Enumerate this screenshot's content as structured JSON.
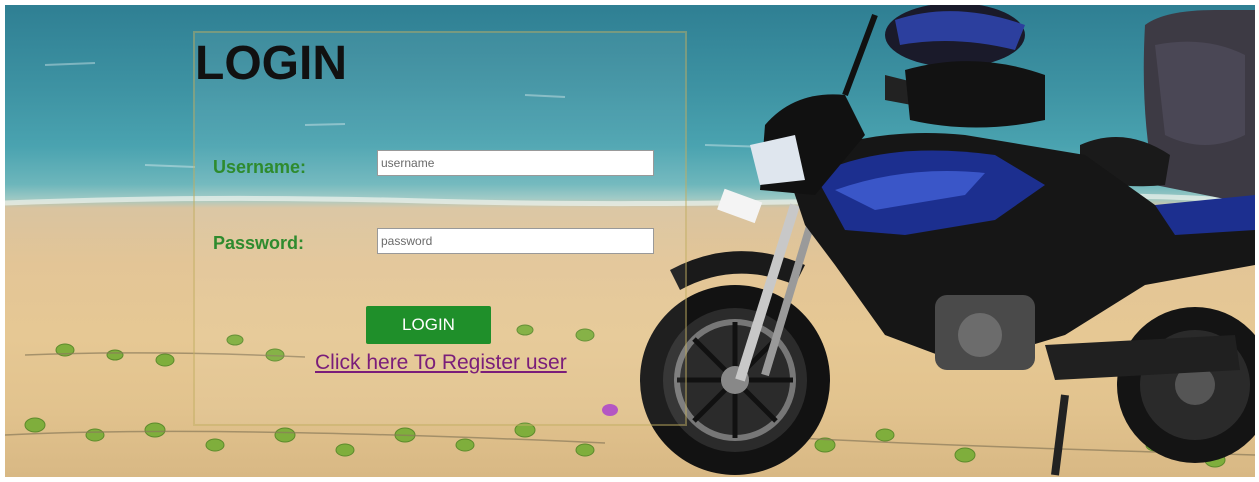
{
  "login": {
    "title": "LOGIN",
    "username_label": "Username:",
    "username_placeholder": "username",
    "username_value": "",
    "password_label": "Password:",
    "password_placeholder": "password",
    "password_value": "",
    "submit_label": "LOGIN",
    "register_link": "Click here To Register user"
  },
  "colors": {
    "label_green": "#2e8b2e",
    "button_green": "#1f8f2a",
    "link_purple": "#7a1d7a",
    "title": "#111111"
  }
}
